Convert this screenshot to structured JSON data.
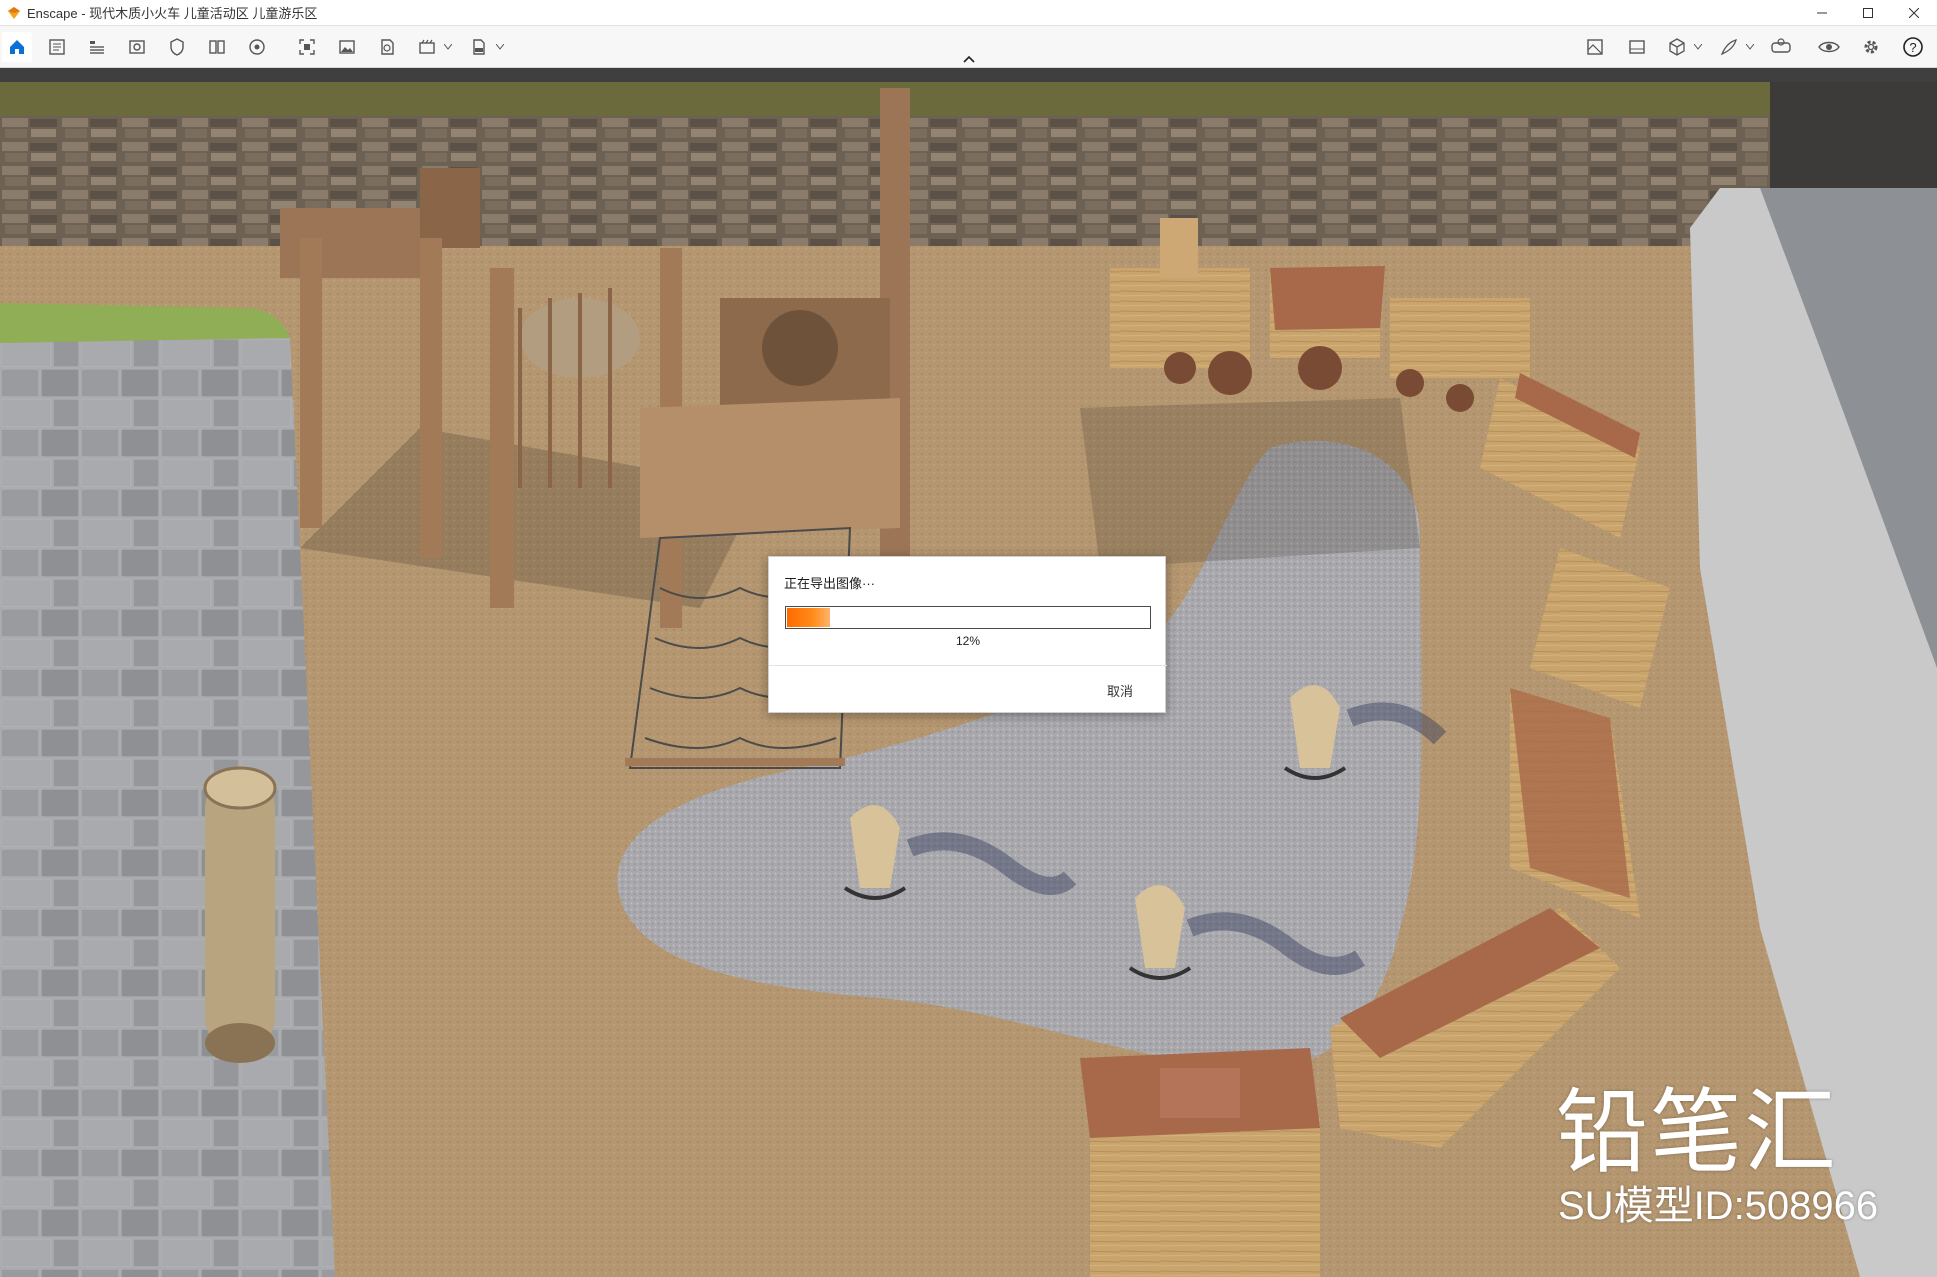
{
  "window": {
    "app_name": "Enscape",
    "title": "Enscape - 现代木质小火车 儿童活动区 儿童游乐区"
  },
  "toolbar": {
    "left_icons": [
      "home-icon",
      "document-icon",
      "list-icon",
      "view-icon",
      "shield-icon",
      "book-icon",
      "settings-wheel-icon",
      "capture-icon",
      "image-icon",
      "panorama-icon",
      "video-icon",
      "export-exe-icon"
    ],
    "right_icons": [
      "asset-library-icon",
      "image-gallery-icon",
      "cube-icon",
      "feather-icon",
      "vr-headset-icon",
      "eye-icon",
      "gear-icon",
      "help-icon"
    ],
    "accent": "#0078d7"
  },
  "dialog": {
    "title": "正在导出图像···",
    "progress_percent": 12,
    "progress_label": "12%",
    "cancel_label": "取消",
    "progress_color": "#ff7a00"
  },
  "watermark": {
    "brand": "铅笔汇",
    "model_id": "SU模型ID:508966"
  }
}
